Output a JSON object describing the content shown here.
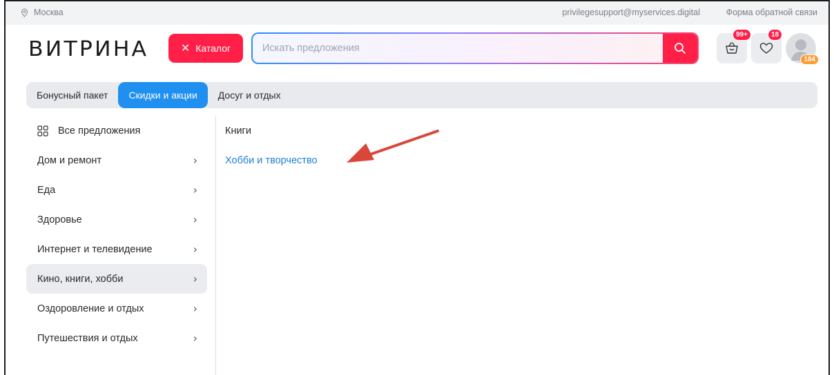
{
  "infobar": {
    "city": "Москва",
    "email": "privilegesupport@myservices.digital",
    "feedback": "Форма обратной связи"
  },
  "header": {
    "logo": "ВИТРИНА",
    "catalog_label": "Каталог",
    "search_placeholder": "Искать предложения",
    "cart_badge": "99+",
    "favorites_badge": "18",
    "points_badge": "184"
  },
  "tabs": [
    {
      "label": "Бонусный пакет",
      "active": false
    },
    {
      "label": "Скидки и акции",
      "active": true
    },
    {
      "label": "Досуг и отдых",
      "active": false
    }
  ],
  "sidebar": {
    "items": [
      {
        "label": "Все предложения"
      },
      {
        "label": "Дом и ремонт"
      },
      {
        "label": "Еда"
      },
      {
        "label": "Здоровье"
      },
      {
        "label": "Интернет и телевидение"
      },
      {
        "label": "Кино, книги, хобби"
      },
      {
        "label": "Оздоровление и отдых"
      },
      {
        "label": "Путешествия и отдых"
      }
    ]
  },
  "content": {
    "heading": "Книги",
    "link": "Хобби и творчество"
  },
  "colors": {
    "accent_red": "#ff1f47",
    "accent_blue": "#1f8ff0",
    "link_blue": "#1f7fd6",
    "annotation_arrow": "#d9473a"
  }
}
